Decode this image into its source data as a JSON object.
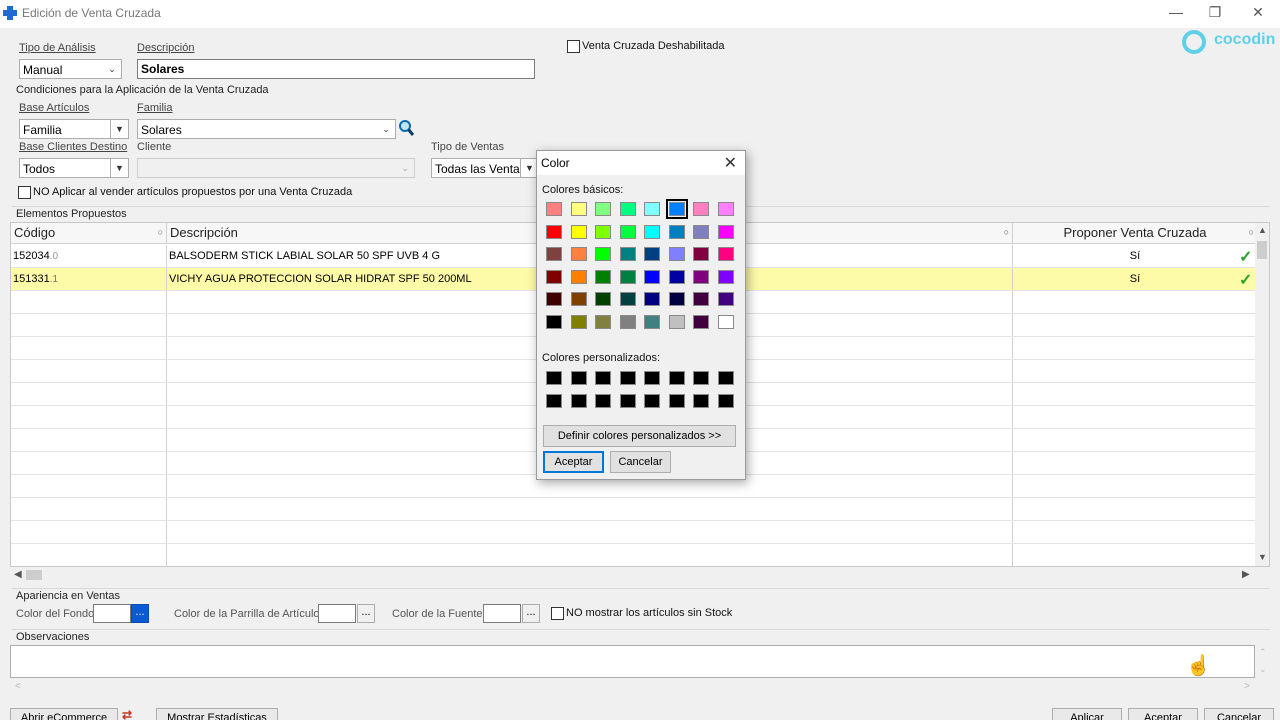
{
  "window": {
    "title": "Edición de Venta Cruzada",
    "minimize": "—",
    "restore": "❐",
    "close": "✕"
  },
  "logo": {
    "text": "cocodin"
  },
  "header": {
    "tipo_analisis_label": "Tipo de Análisis",
    "tipo_analisis_value": "Manual",
    "descripcion_label": "Descripción",
    "descripcion_value": "Solares",
    "deshabilitada_label": "Venta Cruzada Deshabilitada"
  },
  "condiciones": {
    "title": "Condiciones para la Aplicación de la Venta Cruzada",
    "base_articulos_label": "Base Artículos",
    "base_articulos_value": "Familia",
    "familia_label": "Familia",
    "familia_value": "Solares",
    "base_clientes_label": "Base Clientes Destino",
    "base_clientes_value": "Todos",
    "cliente_label": "Cliente",
    "cliente_value": "",
    "tipo_ventas_label": "Tipo de Ventas",
    "tipo_ventas_value": "Todas las Ventas",
    "no_aplicar_label": "NO Aplicar al vender artículos propuestos por una Venta Cruzada"
  },
  "elementos": {
    "title": "Elementos Propuestos",
    "columns": [
      "Código",
      "Descripción",
      "",
      "Proponer Venta Cruzada"
    ],
    "rows": [
      {
        "codigo": "152034",
        "codigo_suffix": ".0",
        "descripcion": "BALSODERM STICK LABIAL SOLAR 50 SPF UVB 4 G",
        "proponer": "Sí"
      },
      {
        "codigo": "151331",
        "codigo_suffix": ".1",
        "descripcion": "VICHY AGUA PROTECCION SOLAR HIDRAT SPF 50 200ML",
        "proponer": "Sí"
      }
    ]
  },
  "apariencia": {
    "title": "Apariencia en Ventas",
    "color_fondo_label": "Color del Fondo:",
    "color_parrilla_label": "Color de la Parrilla de Artículos:",
    "color_fuente_label": "Color de la Fuente:",
    "no_mostrar_label": "NO mostrar los artículos sin Stock",
    "dots": "..."
  },
  "observaciones": {
    "title": "Observaciones"
  },
  "bottom_buttons": [
    "Abrir eCommerce",
    "Mostrar Estadísticas",
    "Aplicar",
    "Aceptar",
    "Cancelar"
  ],
  "color_dialog": {
    "title": "Color",
    "basic_label": "Colores básicos:",
    "custom_label": "Colores personalizados:",
    "define_button": "Definir colores personalizados >>",
    "accept_button": "Aceptar",
    "cancel_button": "Cancelar",
    "basic_colors": [
      [
        "#ff8080",
        "#ffff80",
        "#80ff80",
        "#00ff80",
        "#80ffff",
        "#0080ff",
        "#ff80c0",
        "#ff80ff"
      ],
      [
        "#ff0000",
        "#ffff00",
        "#80ff00",
        "#00ff40",
        "#00ffff",
        "#0080c0",
        "#8080c0",
        "#ff00ff"
      ],
      [
        "#804040",
        "#ff8040",
        "#00ff00",
        "#008080",
        "#004080",
        "#8080ff",
        "#800040",
        "#ff0080"
      ],
      [
        "#800000",
        "#ff8000",
        "#008000",
        "#008040",
        "#0000ff",
        "#0000a0",
        "#800080",
        "#8000ff"
      ],
      [
        "#400000",
        "#804000",
        "#004000",
        "#004040",
        "#000080",
        "#000040",
        "#400040",
        "#400080"
      ],
      [
        "#000000",
        "#808000",
        "#808040",
        "#808080",
        "#408080",
        "#c0c0c0",
        "#400040",
        "#ffffff"
      ]
    ],
    "selected": "#0080ff",
    "custom_colors": [
      [
        "#000000",
        "#000000",
        "#000000",
        "#000000",
        "#000000",
        "#000000",
        "#000000",
        "#000000"
      ],
      [
        "#000000",
        "#000000",
        "#000000",
        "#000000",
        "#000000",
        "#000000",
        "#000000",
        "#000000"
      ]
    ]
  }
}
